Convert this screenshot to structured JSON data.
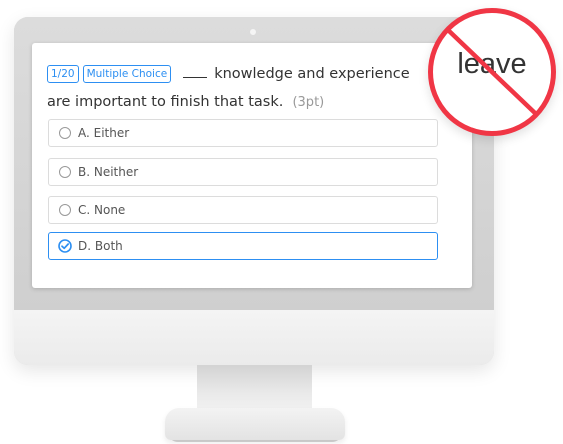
{
  "question": {
    "progress": "1/20",
    "type": "Multiple Choice",
    "text_line1": "knowledge and experience",
    "text_line2": "are important to finish that task.",
    "points": "(3pt)"
  },
  "options": [
    {
      "label": "A. Either",
      "selected": false
    },
    {
      "label": "B. Neither",
      "selected": false
    },
    {
      "label": "C. None",
      "selected": false
    },
    {
      "label": "D. Both",
      "selected": true
    }
  ],
  "stamp": {
    "word": "leave",
    "color": "#f03645"
  },
  "colors": {
    "accent": "#2d8ff2",
    "text": "#333333",
    "muted": "#999999"
  },
  "icons": {
    "unchecked": "radio-unchecked-icon",
    "checked": "radio-checked-icon"
  }
}
